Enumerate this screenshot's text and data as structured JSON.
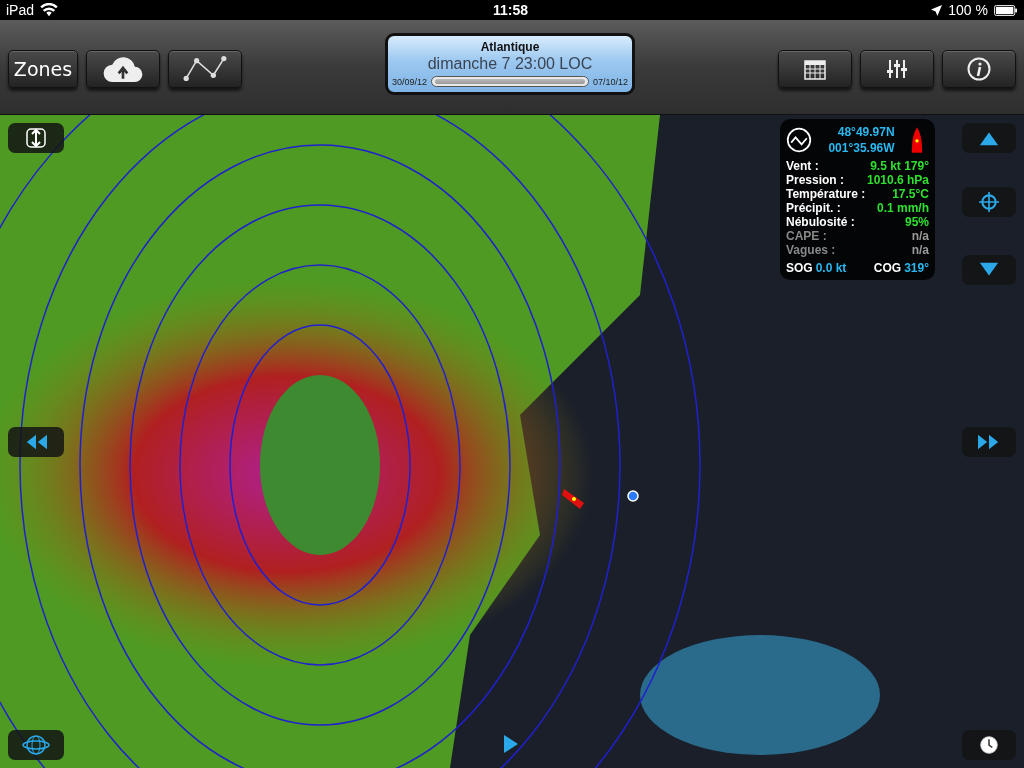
{
  "status_bar": {
    "carrier": "iPad",
    "time": "11:58",
    "battery": "100 %"
  },
  "toolbar": {
    "left_buttons": [
      {
        "kind": "text",
        "label": "Zones"
      },
      {
        "kind": "cloud"
      },
      {
        "kind": "route"
      }
    ],
    "right_buttons": [
      {
        "kind": "calendar"
      },
      {
        "kind": "sliders"
      },
      {
        "kind": "info"
      }
    ]
  },
  "timeline": {
    "zone": "Atlantique",
    "datetime": "dimanche 7 23:00 LOC",
    "start": "30/09/12",
    "end": "07/10/12",
    "level": 1
  },
  "info_panel": {
    "latitude": "48°49.97N",
    "longitude": "001°35.96W",
    "rows": [
      {
        "label": "Vent :",
        "value": "9.5 kt 179°",
        "disabled": false
      },
      {
        "label": "Pression :",
        "value": "1010.6 hPa",
        "disabled": false
      },
      {
        "label": "Température :",
        "value": "17.5°C",
        "disabled": false
      },
      {
        "label": "Précipit. :",
        "value": "0.1 mm/h",
        "disabled": false
      },
      {
        "label": "Nébulosité :",
        "value": "95%",
        "disabled": false
      },
      {
        "label": "CAPE :",
        "value": "n/a",
        "disabled": true
      },
      {
        "label": "Vagues :",
        "value": "n/a",
        "disabled": true
      }
    ],
    "sog_label": "SOG",
    "sog": "0.0 kt",
    "cog_label": "COG",
    "cog": "319°"
  }
}
